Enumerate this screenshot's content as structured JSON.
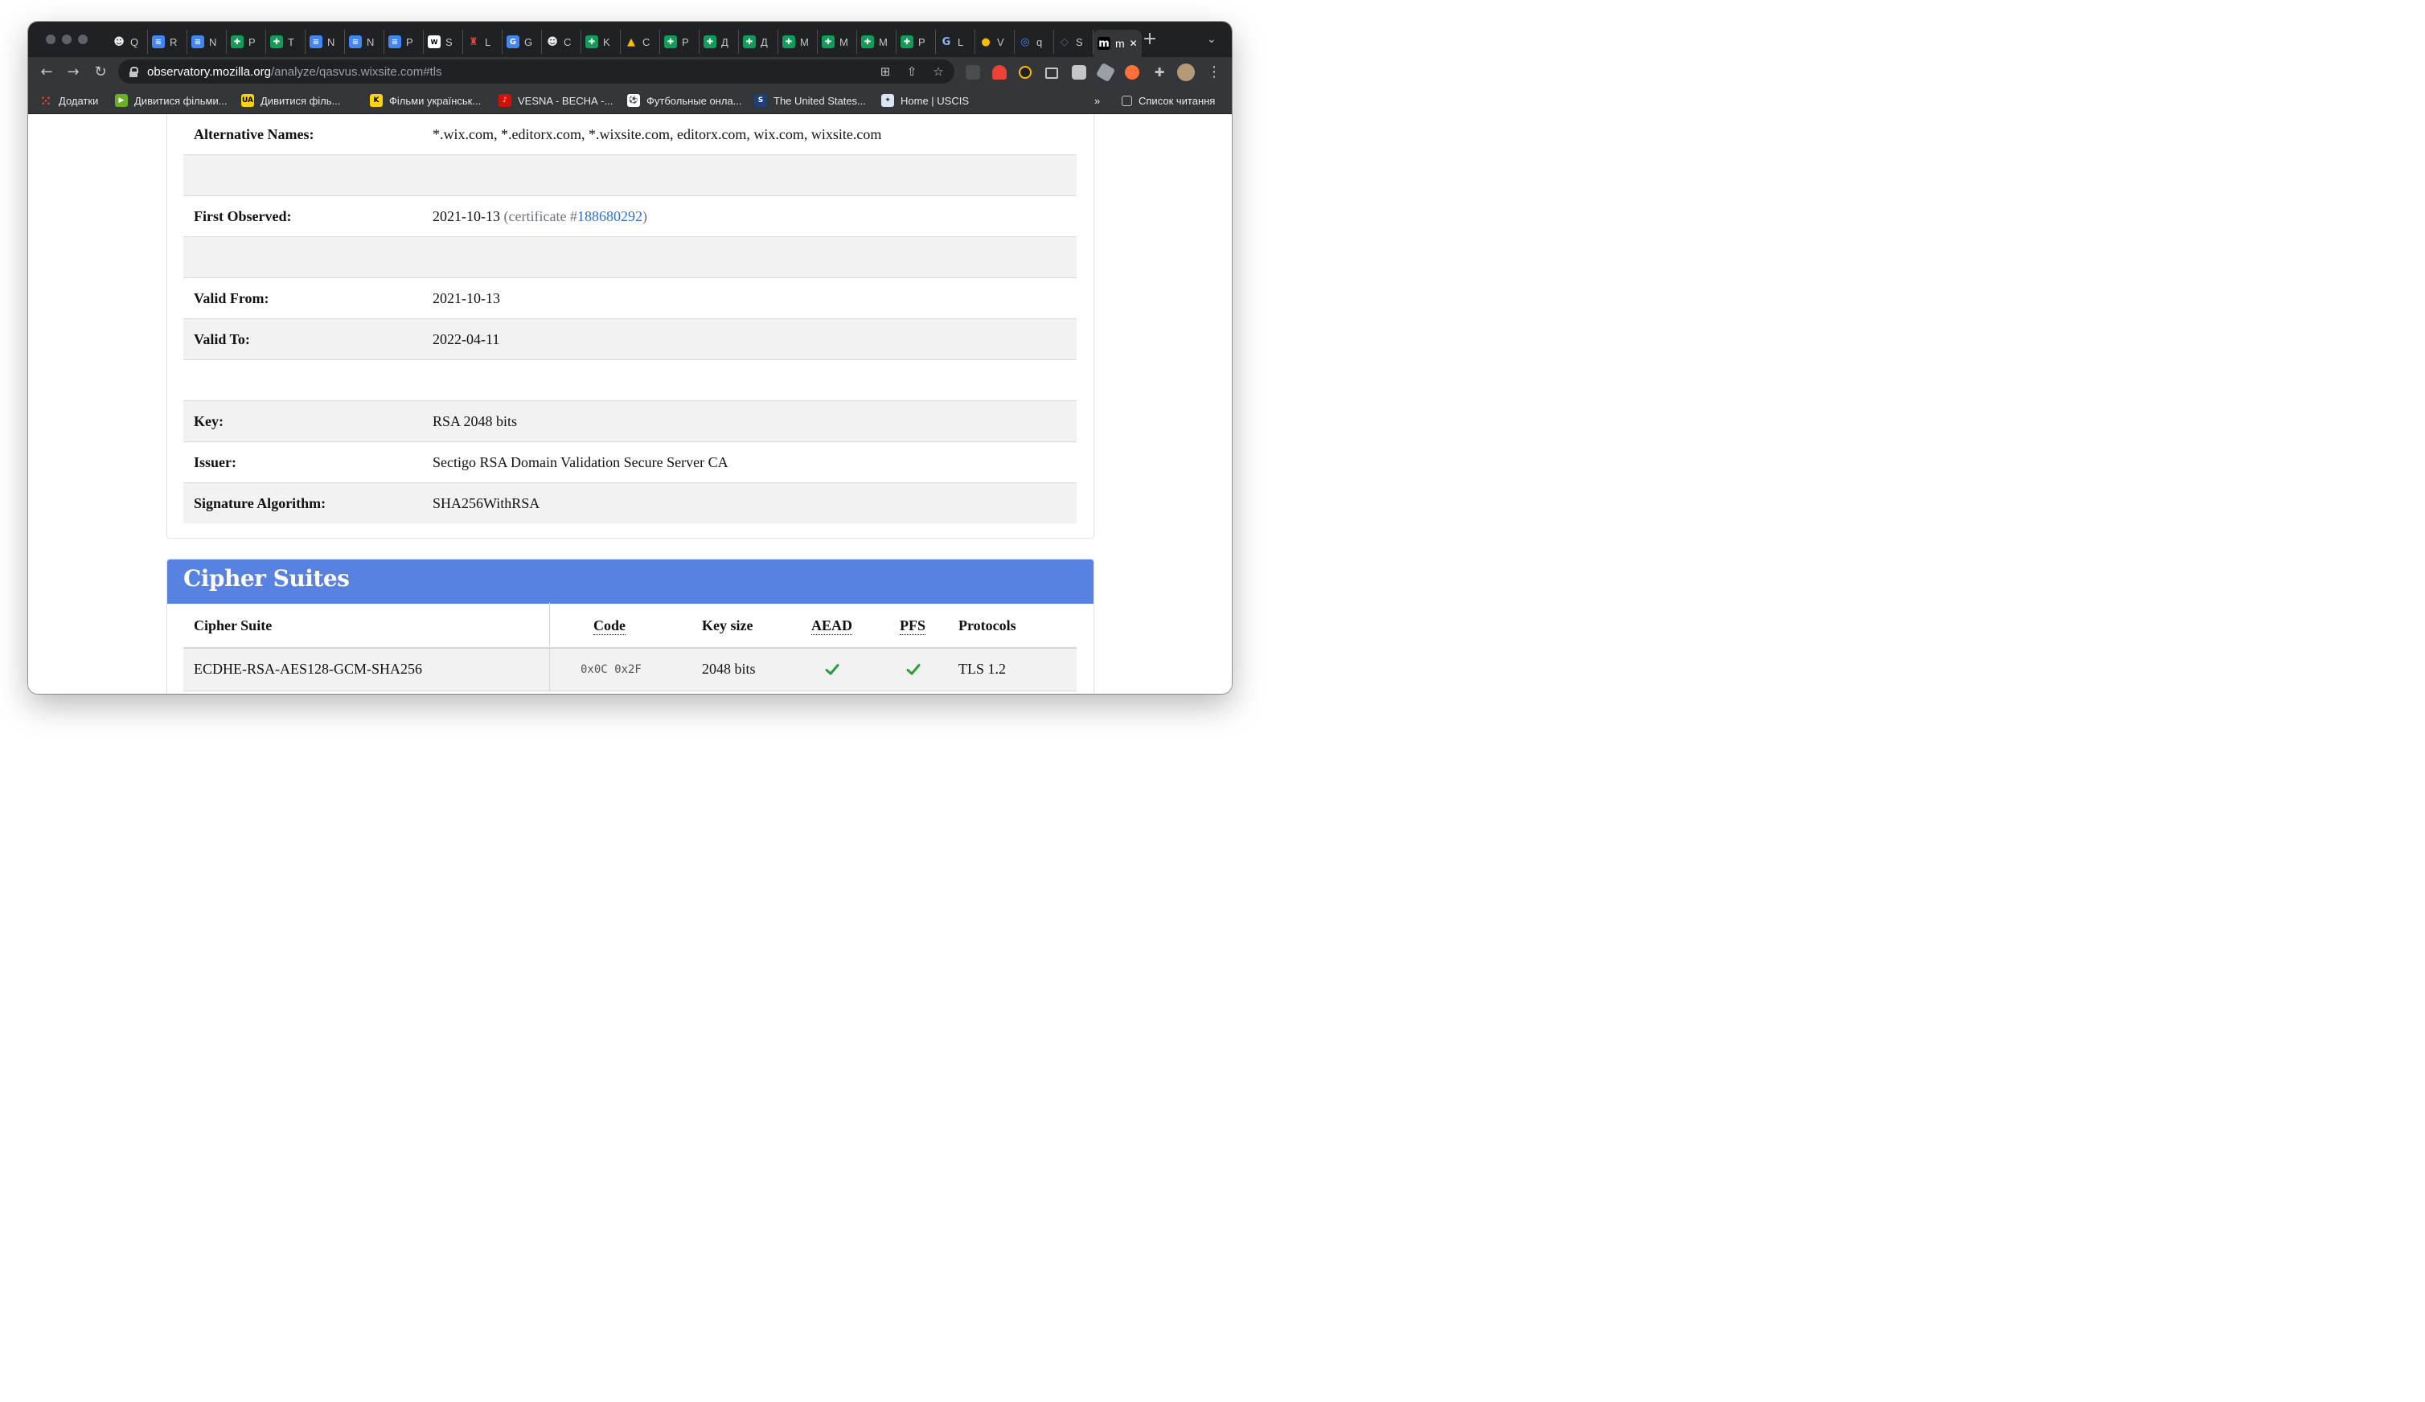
{
  "browser": {
    "tabs": [
      {
        "letter": "Q",
        "icon": "contact-icon",
        "color": "#e8eaed"
      },
      {
        "letter": "R",
        "icon": "docs-icon",
        "color": "#4285f4"
      },
      {
        "letter": "N",
        "icon": "docs-icon",
        "color": "#4285f4"
      },
      {
        "letter": "P",
        "icon": "sheets-icon",
        "color": "#0f9d58"
      },
      {
        "letter": "T",
        "icon": "sheets-icon",
        "color": "#0f9d58"
      },
      {
        "letter": "N",
        "icon": "docs-icon",
        "color": "#4285f4"
      },
      {
        "letter": "N",
        "icon": "docs-icon",
        "color": "#4285f4"
      },
      {
        "letter": "P",
        "icon": "docs-icon",
        "color": "#4285f4"
      },
      {
        "letter": "S",
        "icon": "wix-icon",
        "color": "#ffffff"
      },
      {
        "letter": "L",
        "icon": "lighthouse-icon",
        "color": "#f44336"
      },
      {
        "letter": "G",
        "icon": "translate-icon",
        "color": "#4285f4"
      },
      {
        "letter": "C",
        "icon": "contact-icon",
        "color": "#e8eaed"
      },
      {
        "letter": "K",
        "icon": "sheets-icon",
        "color": "#0f9d58"
      },
      {
        "letter": "C",
        "icon": "drive-icon",
        "color": "#fbbc04"
      },
      {
        "letter": "P",
        "icon": "sheets-icon",
        "color": "#0f9d58"
      },
      {
        "letter": "Д",
        "icon": "sheets-icon",
        "color": "#0f9d58"
      },
      {
        "letter": "Д",
        "icon": "sheets-icon",
        "color": "#0f9d58"
      },
      {
        "letter": "M",
        "icon": "sheets-icon",
        "color": "#0f9d58"
      },
      {
        "letter": "M",
        "icon": "sheets-icon",
        "color": "#0f9d58"
      },
      {
        "letter": "M",
        "icon": "sheets-icon",
        "color": "#0f9d58"
      },
      {
        "letter": "P",
        "icon": "sheets-icon",
        "color": "#0f9d58"
      },
      {
        "letter": "L",
        "icon": "gt-icon",
        "color": "#8ab4f8"
      },
      {
        "letter": "V",
        "icon": "chrome-icon",
        "color": "#fbbc04"
      },
      {
        "letter": "q",
        "icon": "compass-icon",
        "color": "#4285f4"
      },
      {
        "letter": "S",
        "icon": "page-icon",
        "color": "#5f6368"
      },
      {
        "letter": "m",
        "icon": "mozilla-icon",
        "color": "#000000"
      }
    ],
    "active_close": "✕",
    "new_tab": "+",
    "tab_menu": "⌄",
    "url_host": "observatory.mozilla.org",
    "url_path": "/analyze/qasvus.wixsite.com#tls",
    "bookmarks": [
      {
        "label": "Додатки",
        "icon": "apps-icon",
        "color": "#ea4335"
      },
      {
        "label": "Дивитися фільми...",
        "icon": "movie-icon",
        "color": "#6ab023"
      },
      {
        "label": "Дивитися філь...",
        "icon": "ua-icon",
        "color": "#ffd500"
      },
      {
        "label": "Фільми українськ...",
        "icon": "k-icon",
        "color": "#ffd500"
      },
      {
        "label": "VESNA - ВЕСНА -...",
        "icon": "lastfm-icon",
        "color": "#d51007"
      },
      {
        "label": "Футбольные онла...",
        "icon": "ball-icon",
        "color": "#ffffff"
      },
      {
        "label": "The United States...",
        "icon": "ssa-icon",
        "color": "#1d3f7a"
      },
      {
        "label": "Home | USCIS",
        "icon": "uscis-icon",
        "color": "#dce6f2"
      }
    ],
    "bookmarks_more": "»",
    "reading_list": "Список читання"
  },
  "certificate": {
    "rows": [
      {
        "key": "Alternative Names:",
        "value": "*.wix.com, *.editorx.com, *.wixsite.com, editorx.com, wix.com, wixsite.com"
      },
      {
        "key": "",
        "value": ""
      },
      {
        "key": "First Observed:",
        "value": "2021-10-13"
      },
      {
        "key": "",
        "value": ""
      },
      {
        "key": "Valid From:",
        "value": "2021-10-13"
      },
      {
        "key": "Valid To:",
        "value": "2022-04-11"
      },
      {
        "key": "",
        "value": ""
      },
      {
        "key": "Key:",
        "value": "RSA 2048 bits"
      },
      {
        "key": "Issuer:",
        "value": "Sectigo RSA Domain Validation Secure Server CA"
      },
      {
        "key": "Signature Algorithm:",
        "value": "SHA256WithRSA"
      }
    ],
    "first_observed_prefix": "(certificate #",
    "first_observed_link": "188680292",
    "first_observed_suffix": ")"
  },
  "cipher_suites": {
    "title": "Cipher Suites",
    "headers": {
      "suite": "Cipher Suite",
      "code": "Code",
      "key_size": "Key size",
      "aead": "AEAD",
      "pfs": "PFS",
      "protocols": "Protocols"
    },
    "rows": [
      {
        "suite": "ECDHE-RSA-AES128-GCM-SHA256",
        "code": "0x0C 0x2F",
        "key_size": "2048 bits",
        "aead": true,
        "pfs": true,
        "protocols": "TLS 1.2"
      }
    ]
  }
}
